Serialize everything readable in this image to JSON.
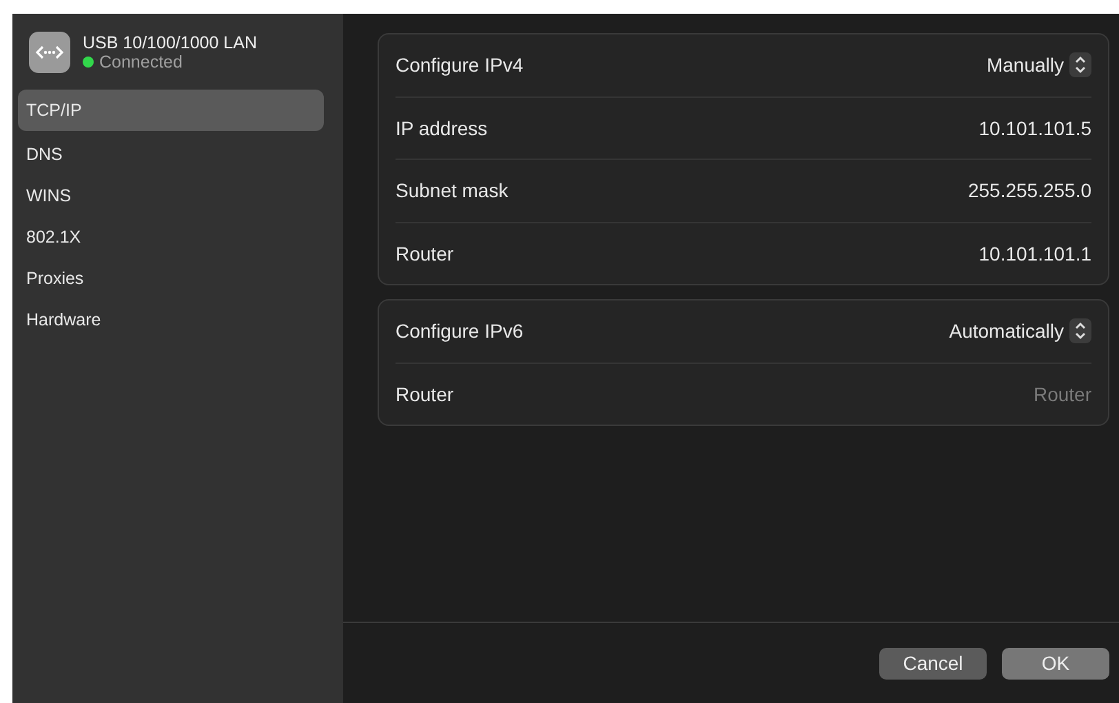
{
  "sidebar": {
    "device": {
      "name": "USB 10/100/1000 LAN",
      "status": "Connected",
      "color": "#32d74b"
    },
    "items": [
      {
        "label": "TCP/IP",
        "selected": true
      },
      {
        "label": "DNS",
        "selected": false
      },
      {
        "label": "WINS",
        "selected": false
      },
      {
        "label": "802.1X",
        "selected": false
      },
      {
        "label": "Proxies",
        "selected": false
      },
      {
        "label": "Hardware",
        "selected": false
      }
    ]
  },
  "sections": [
    {
      "rows": [
        {
          "label": "Configure IPv4",
          "kind": "popup",
          "value": "Manually"
        },
        {
          "label": "IP address",
          "kind": "text",
          "value": "10.101.101.5"
        },
        {
          "label": "Subnet mask",
          "kind": "text",
          "value": "255.255.255.0"
        },
        {
          "label": "Router",
          "kind": "text",
          "value": "10.101.101.1"
        }
      ]
    },
    {
      "rows": [
        {
          "label": "Configure IPv6",
          "kind": "popup",
          "value": "Automatically"
        },
        {
          "label": "Router",
          "kind": "field",
          "placeholder": "Router"
        }
      ]
    }
  ],
  "buttons": [
    {
      "label": "Cancel",
      "kind": "secondary"
    },
    {
      "label": "OK",
      "kind": "default"
    }
  ]
}
